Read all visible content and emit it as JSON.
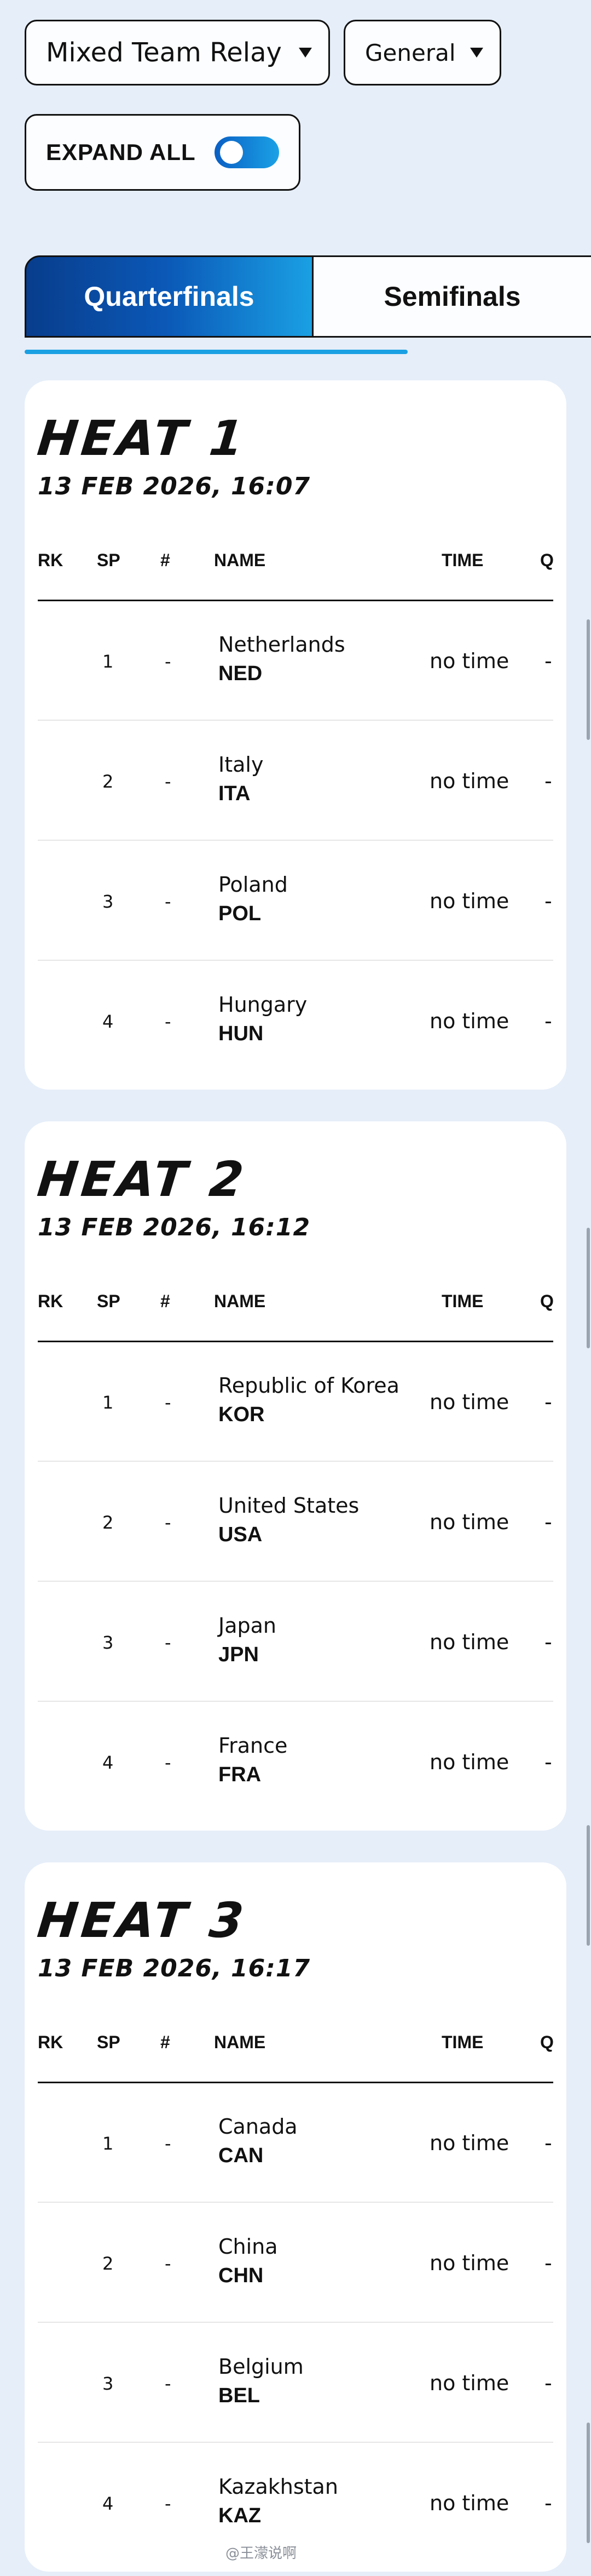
{
  "filters": {
    "event": "Mixed Team Relay",
    "category": "General"
  },
  "expand_all": {
    "label": "EXPAND ALL",
    "on": true
  },
  "tabs": [
    {
      "label": "Quarterfinals",
      "active": true
    },
    {
      "label": "Semifinals",
      "active": false
    }
  ],
  "columns": {
    "rk": "RK",
    "sp": "SP",
    "num": "#",
    "name": "NAME",
    "time": "TIME",
    "q": "Q"
  },
  "heats": [
    {
      "title": "HEAT 1",
      "date": "13 FEB 2026, 16:07",
      "rows": [
        {
          "sp": "1",
          "num": "-",
          "name": "Netherlands",
          "code": "NED",
          "time": "no time",
          "q": "-"
        },
        {
          "sp": "2",
          "num": "-",
          "name": "Italy",
          "code": "ITA",
          "time": "no time",
          "q": "-"
        },
        {
          "sp": "3",
          "num": "-",
          "name": "Poland",
          "code": "POL",
          "time": "no time",
          "q": "-"
        },
        {
          "sp": "4",
          "num": "-",
          "name": "Hungary",
          "code": "HUN",
          "time": "no time",
          "q": "-"
        }
      ]
    },
    {
      "title": "HEAT 2",
      "date": "13 FEB 2026, 16:12",
      "rows": [
        {
          "sp": "1",
          "num": "-",
          "name": "Republic of Korea",
          "code": "KOR",
          "time": "no time",
          "q": "-"
        },
        {
          "sp": "2",
          "num": "-",
          "name": "United States",
          "code": "USA",
          "time": "no time",
          "q": "-"
        },
        {
          "sp": "3",
          "num": "-",
          "name": "Japan",
          "code": "JPN",
          "time": "no time",
          "q": "-"
        },
        {
          "sp": "4",
          "num": "-",
          "name": "France",
          "code": "FRA",
          "time": "no time",
          "q": "-"
        }
      ]
    },
    {
      "title": "HEAT 3",
      "date": "13 FEB 2026, 16:17",
      "rows": [
        {
          "sp": "1",
          "num": "-",
          "name": "Canada",
          "code": "CAN",
          "time": "no time",
          "q": "-"
        },
        {
          "sp": "2",
          "num": "-",
          "name": "China",
          "code": "CHN",
          "time": "no time",
          "q": "-"
        },
        {
          "sp": "3",
          "num": "-",
          "name": "Belgium",
          "code": "BEL",
          "time": "no time",
          "q": "-"
        },
        {
          "sp": "4",
          "num": "-",
          "name": "Kazakhstan",
          "code": "KAZ",
          "time": "no time",
          "q": "-"
        }
      ]
    }
  ],
  "watermark": "@王濛说啊",
  "colors": {
    "page_bg": "#e6eef9",
    "accent_dark": "#083d8c",
    "accent_light": "#1aa0e3"
  }
}
